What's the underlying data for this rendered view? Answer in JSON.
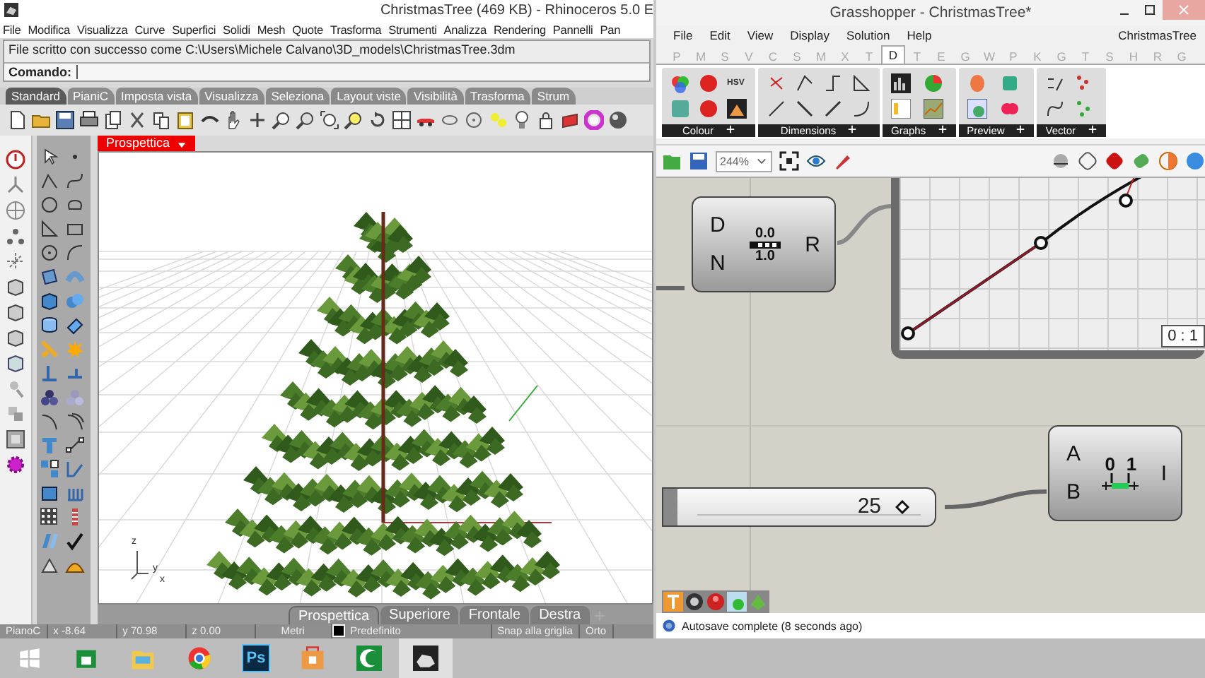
{
  "rhino": {
    "title": "ChristmasTree (469 KB) - Rhinoceros 5.0 E",
    "menu": [
      "File",
      "Modifica",
      "Visualizza",
      "Curve",
      "Superfici",
      "Solidi",
      "Mesh",
      "Quote",
      "Trasforma",
      "Strumenti",
      "Analizza",
      "Rendering",
      "Pannelli",
      "Pan"
    ],
    "history": "File scritto con successo come C:\\Users\\Michele Calvano\\3D_models\\ChristmasTree.3dm",
    "command_label": "Comando:",
    "toolbar_tabs": [
      {
        "label": "Standard",
        "selected": true
      },
      {
        "label": "PianiC",
        "selected": false
      },
      {
        "label": "Imposta vista",
        "selected": false
      },
      {
        "label": "Visualizza",
        "selected": false
      },
      {
        "label": "Seleziona",
        "selected": false
      },
      {
        "label": "Layout viste",
        "selected": false
      },
      {
        "label": "Visibilità",
        "selected": false
      },
      {
        "label": "Trasforma",
        "selected": false
      },
      {
        "label": "Strum",
        "selected": false
      }
    ],
    "viewport": {
      "title": "Prospettica",
      "axis_labels": [
        "z",
        "y",
        "x"
      ]
    },
    "viewport_tabs": [
      {
        "label": "Prospettica",
        "selected": true
      },
      {
        "label": "Superiore",
        "selected": false
      },
      {
        "label": "Frontale",
        "selected": false
      },
      {
        "label": "Destra",
        "selected": false
      }
    ],
    "status_bar": {
      "plane": "PianoC",
      "x": "x -8.64",
      "y": "y 70.98",
      "z": "z 0.00",
      "units": "Metri",
      "layer": "Predefinito",
      "snap": "Snap alla griglia",
      "ortho": "Orto"
    }
  },
  "grasshopper": {
    "title": "Grasshopper - ChristmasTree*",
    "menu": [
      "File",
      "Edit",
      "View",
      "Display",
      "Solution",
      "Help"
    ],
    "document": "ChristmasTree",
    "tabs": [
      {
        "label": "P",
        "selected": false
      },
      {
        "label": "M",
        "selected": false
      },
      {
        "label": "S",
        "selected": false
      },
      {
        "label": "V",
        "selected": false
      },
      {
        "label": "C",
        "selected": false
      },
      {
        "label": "S",
        "selected": false
      },
      {
        "label": "M",
        "selected": false
      },
      {
        "label": "X",
        "selected": false
      },
      {
        "label": "T",
        "selected": false
      },
      {
        "label": "D",
        "selected": true
      },
      {
        "label": "T",
        "selected": false
      },
      {
        "label": "E",
        "selected": false
      },
      {
        "label": "G",
        "selected": false
      },
      {
        "label": "W",
        "selected": false
      },
      {
        "label": "P",
        "selected": false
      },
      {
        "label": "K",
        "selected": false
      },
      {
        "label": "G",
        "selected": false
      },
      {
        "label": "T",
        "selected": false
      },
      {
        "label": "S",
        "selected": false
      },
      {
        "label": "H",
        "selected": false
      },
      {
        "label": "R",
        "selected": false
      },
      {
        "label": "G",
        "selected": false
      }
    ],
    "panels": [
      {
        "label": "Colour",
        "kind": "colour"
      },
      {
        "label": "Dimensions",
        "kind": "dimensions"
      },
      {
        "label": "Graphs",
        "kind": "graphs"
      },
      {
        "label": "Preview",
        "kind": "preview"
      },
      {
        "label": "Vector",
        "kind": "vector"
      }
    ],
    "colour_icon_text": "HSV",
    "zoom": "244%",
    "graph_mapper": {
      "inputs": [
        "D",
        "N"
      ],
      "output": "R",
      "labels": [
        "0.0",
        "1.0"
      ]
    },
    "graph": {
      "ratio": "0 : 1"
    },
    "slider": {
      "value": "25",
      "level": 0.92
    },
    "range": {
      "inputs": [
        "A",
        "B"
      ],
      "output": "I",
      "labels": [
        "0",
        "1"
      ]
    },
    "status": "Autosave complete (8 seconds ago)"
  },
  "taskbar": {
    "apps": [
      {
        "kind": "windows",
        "selected": false
      },
      {
        "kind": "store",
        "selected": false
      },
      {
        "kind": "explorer",
        "selected": false
      },
      {
        "kind": "chrome",
        "selected": false
      },
      {
        "kind": "photoshop",
        "label": "Ps",
        "selected": false
      },
      {
        "kind": "bag",
        "selected": false
      },
      {
        "kind": "crescent",
        "selected": false
      },
      {
        "kind": "rhino",
        "selected": true
      }
    ]
  }
}
